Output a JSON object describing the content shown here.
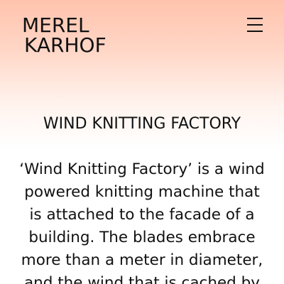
{
  "header": {
    "logo_line1": "MEREL",
    "logo_line2": "KARHOF",
    "menu_icon": "hamburger-menu-icon"
  },
  "project": {
    "title": "WIND KNITTING FACTORY",
    "description_lines": [
      "‘Wind Knitting Factory’ is a wind",
      "powered knitting machine that",
      "is attached to the facade of a",
      "building. The blades embrace",
      "more than a meter in diameter,",
      "and the wind that is cached by"
    ]
  },
  "colors": {
    "gradient_top": "#ffc3ad",
    "background": "#ffffff",
    "text": "#111111"
  }
}
